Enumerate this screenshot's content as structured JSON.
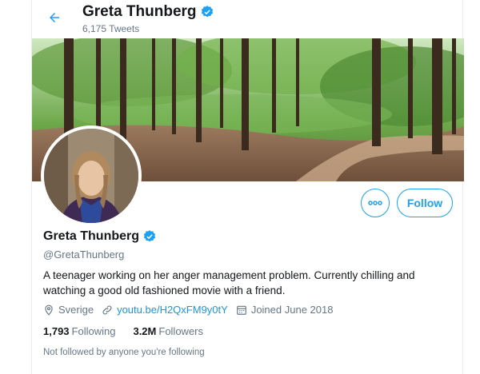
{
  "header": {
    "title": "Greta Thunberg",
    "tweet_count": "6,175 Tweets"
  },
  "actions": {
    "follow_label": "Follow"
  },
  "profile": {
    "name": "Greta Thunberg",
    "handle": "@GretaThunberg",
    "bio": "A teenager working on her anger management problem. Currently chilling and watching a good old fashioned movie with a friend.",
    "location": "Sverige",
    "website": "youtu.be/H2QxFM9y0tY",
    "joined": "Joined June 2018",
    "following_count": "1,793",
    "following_label": "Following",
    "followers_count": "3.2M",
    "followers_label": "Followers",
    "followed_note": "Not followed by anyone you're following"
  },
  "icons": {
    "back": "arrow-left-icon",
    "verified": "verified-badge-icon",
    "location": "location-pin-icon",
    "link": "link-icon",
    "calendar": "calendar-icon",
    "more": "more-dots-icon"
  },
  "colors": {
    "accent": "#1da1f2",
    "link": "#1b95e0",
    "secondary_text": "#657786",
    "primary_text": "#14171a"
  }
}
